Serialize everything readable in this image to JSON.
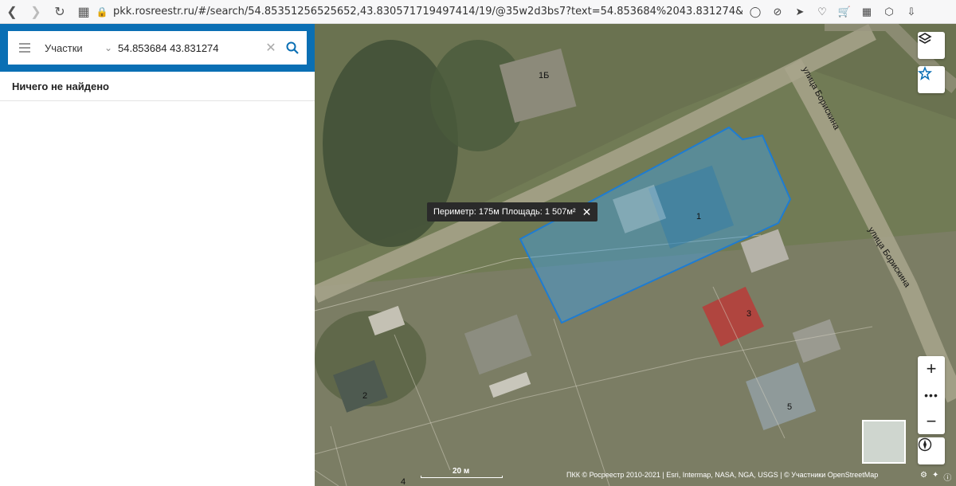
{
  "browser": {
    "url": "pkk.rosreestr.ru/#/search/54.85351256525652,43.830571719497414/19/@35w2d3bs7?text=54.853684%2043.831274&type=1&nameTab&indexTa",
    "back_icon": "arrow-left-icon",
    "forward_icon": "arrow-right-icon",
    "reload_icon": "reload-icon"
  },
  "search": {
    "type_label": "Участки",
    "query": "54.853684 43.831274"
  },
  "results": {
    "message": "Ничего не найдено"
  },
  "map": {
    "measure_tooltip": "Периметр: 175м Площадь: 1 507м²",
    "parcels": [
      "1Б",
      "1",
      "2",
      "3",
      "4",
      "5"
    ],
    "streets": [
      "улица Борискина",
      "улица Борискина"
    ],
    "scale_label": "20 м",
    "attribution": "ПКК © Росреестр 2010-2021 | Esri, Intermap, NASA, NGA, USGS | © Участники OpenStreetMap",
    "accent_color": "#0a6fb4"
  }
}
